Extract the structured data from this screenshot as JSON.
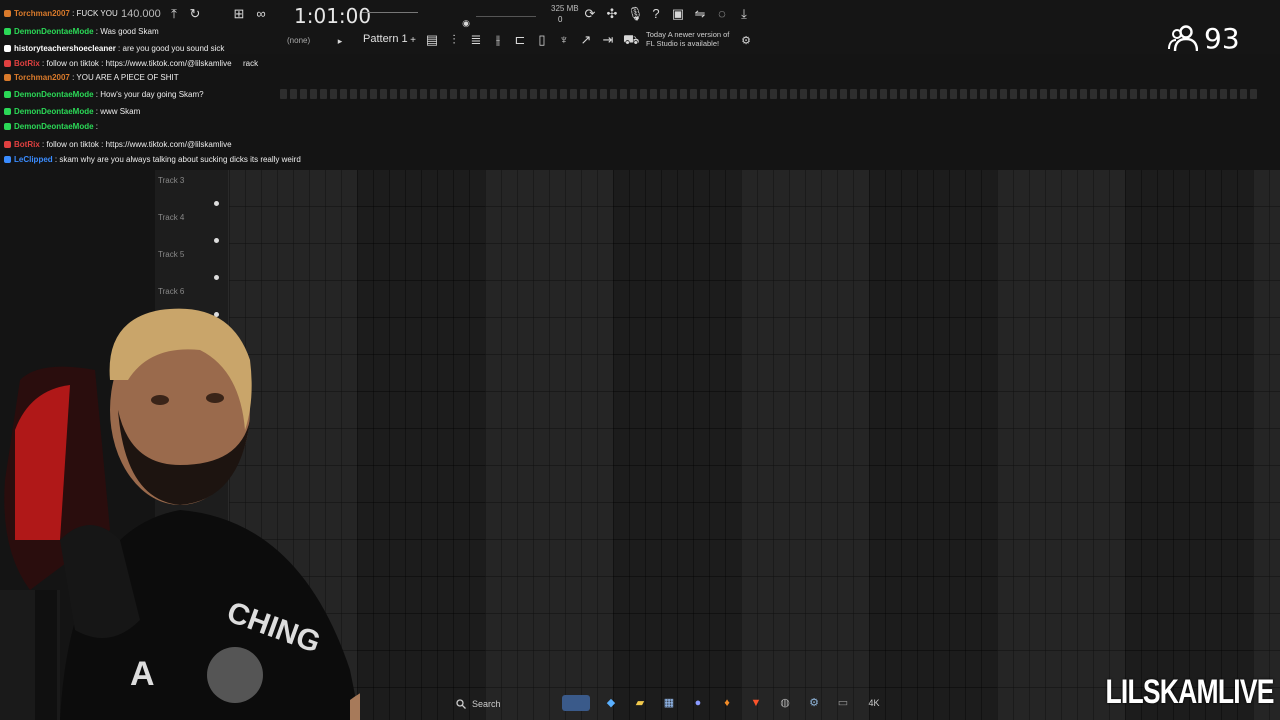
{
  "toolbar": {
    "tempo": "140.000",
    "time_display": "1:01:00",
    "pattern_label": "Pattern 1",
    "pattern_none": "(none)",
    "memory": "325 MB",
    "memory_sub": "0",
    "news_date": "Today",
    "news_text_1": "A newer version of",
    "news_text_2": "FL Studio is available!"
  },
  "viewers": {
    "count": "93"
  },
  "chat": {
    "messages": [
      {
        "user": "Torchman2007",
        "text": " : FUCK YOU",
        "color": "#d97a2b"
      },
      {
        "user": "DemonDeontaeMode",
        "text": " : Was good Skam",
        "color": "#2bd957"
      },
      {
        "user": "historyteachershoecleaner",
        "text": " : are you good you sound sick",
        "color": "#ffffff"
      },
      {
        "user": "BotRix",
        "text": " : follow on tiktok : https://www.tiktok.com/@lilskamlive",
        "color": "#e04040"
      },
      {
        "user": "Torchman2007",
        "text": " : YOU ARE A PIECE OF SHIT",
        "color": "#d97a2b"
      },
      {
        "user": "DemonDeontaeMode",
        "text": " : How's your day going Skam?",
        "color": "#2bd957"
      },
      {
        "user": "DemonDeontaeMode",
        "text": " : www Skam",
        "color": "#2bd957"
      },
      {
        "user": "DemonDeontaeMode",
        "text": " :",
        "color": "#2bd957"
      },
      {
        "user": "BotRix",
        "text": " : follow on tiktok : https://www.tiktok.com/@lilskamlive",
        "color": "#e04040"
      },
      {
        "user": "LeClipped",
        "text": " : skam why are you always talking about sucking dicks its really weird",
        "color": "#3a8cff"
      }
    ],
    "overlay_text": "rack"
  },
  "playlist": {
    "tracks": [
      "Track 3",
      "Track 4",
      "Track 5",
      "Track 6"
    ]
  },
  "taskbar": {
    "search_label": "Search"
  },
  "brand": {
    "text": "LILSKAMLIVE"
  },
  "colors": {
    "accent": "#e04040",
    "background": "#141414"
  }
}
